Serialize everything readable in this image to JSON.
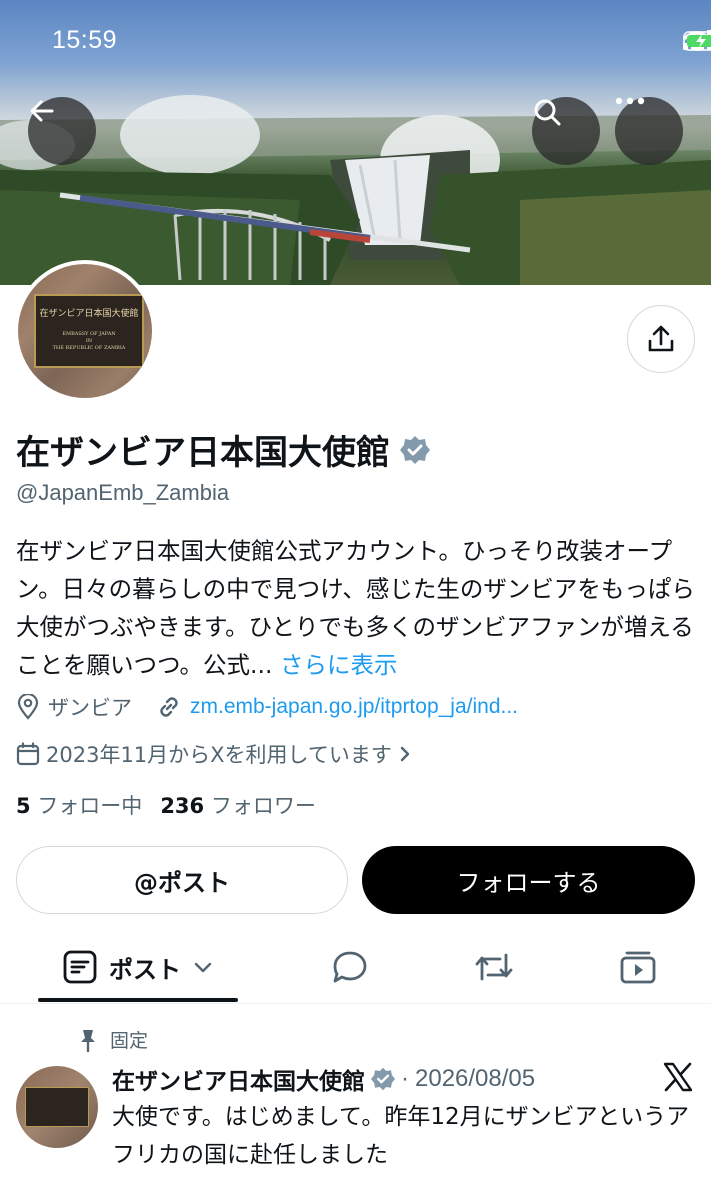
{
  "status_bar": {
    "time": "15:59"
  },
  "profile": {
    "display_name": "在ザンビア日本国大使館",
    "handle": "@JapanEmb_Zambia",
    "bio": "在ザンビア日本国大使館公式アカウント。ひっそり改装オープン。日々の暮らしの中で見つけ、感じた生のザンビアをもっぱら大使がつぶやきます。ひとりでも多くのザンビアファンが増えることを願いつつ。公式...",
    "bio_more": "さらに表示",
    "location": "ザンビア",
    "website": "zm.emb-japan.go.jp/itprtop_ja/ind...",
    "joined": "2023年11月からXを利用しています",
    "following_count": "5",
    "following_label": "フォロー中",
    "followers_count": "236",
    "followers_label": "フォロワー",
    "avatar_plaque": {
      "title": "在ザンビア日本国大使館",
      "line1": "EMBASSY OF JAPAN",
      "line2": "IN",
      "line3": "THE REPUBLIC OF ZAMBIA"
    }
  },
  "actions": {
    "mention_label": "@ポスト",
    "follow_label": "フォローする"
  },
  "tabs": {
    "posts_label": "ポスト"
  },
  "pinned_post": {
    "pinned_label": "固定",
    "author": "在ザンビア日本国大使館",
    "separator": "·",
    "date": "2026/08/05",
    "text": "大使です。はじめまして。昨年12月にザンビアというアフリカの国に赴任しました"
  },
  "icons": {
    "back": "arrow-left-icon",
    "search": "search-icon",
    "more": "more-horizontal-icon",
    "share": "share-icon",
    "verified": "verified-badge-icon",
    "location": "location-pin-icon",
    "link": "link-icon",
    "calendar": "calendar-icon",
    "reply": "speech-bubble-icon",
    "repost": "repost-icon",
    "media": "media-icon",
    "pin": "pin-icon",
    "x_logo": "x-logo-icon"
  },
  "colors": {
    "accent": "#1d9bf0",
    "text": "#0f1419",
    "muted": "#536471",
    "verified": "#829aab",
    "follow_button": "#000000"
  }
}
